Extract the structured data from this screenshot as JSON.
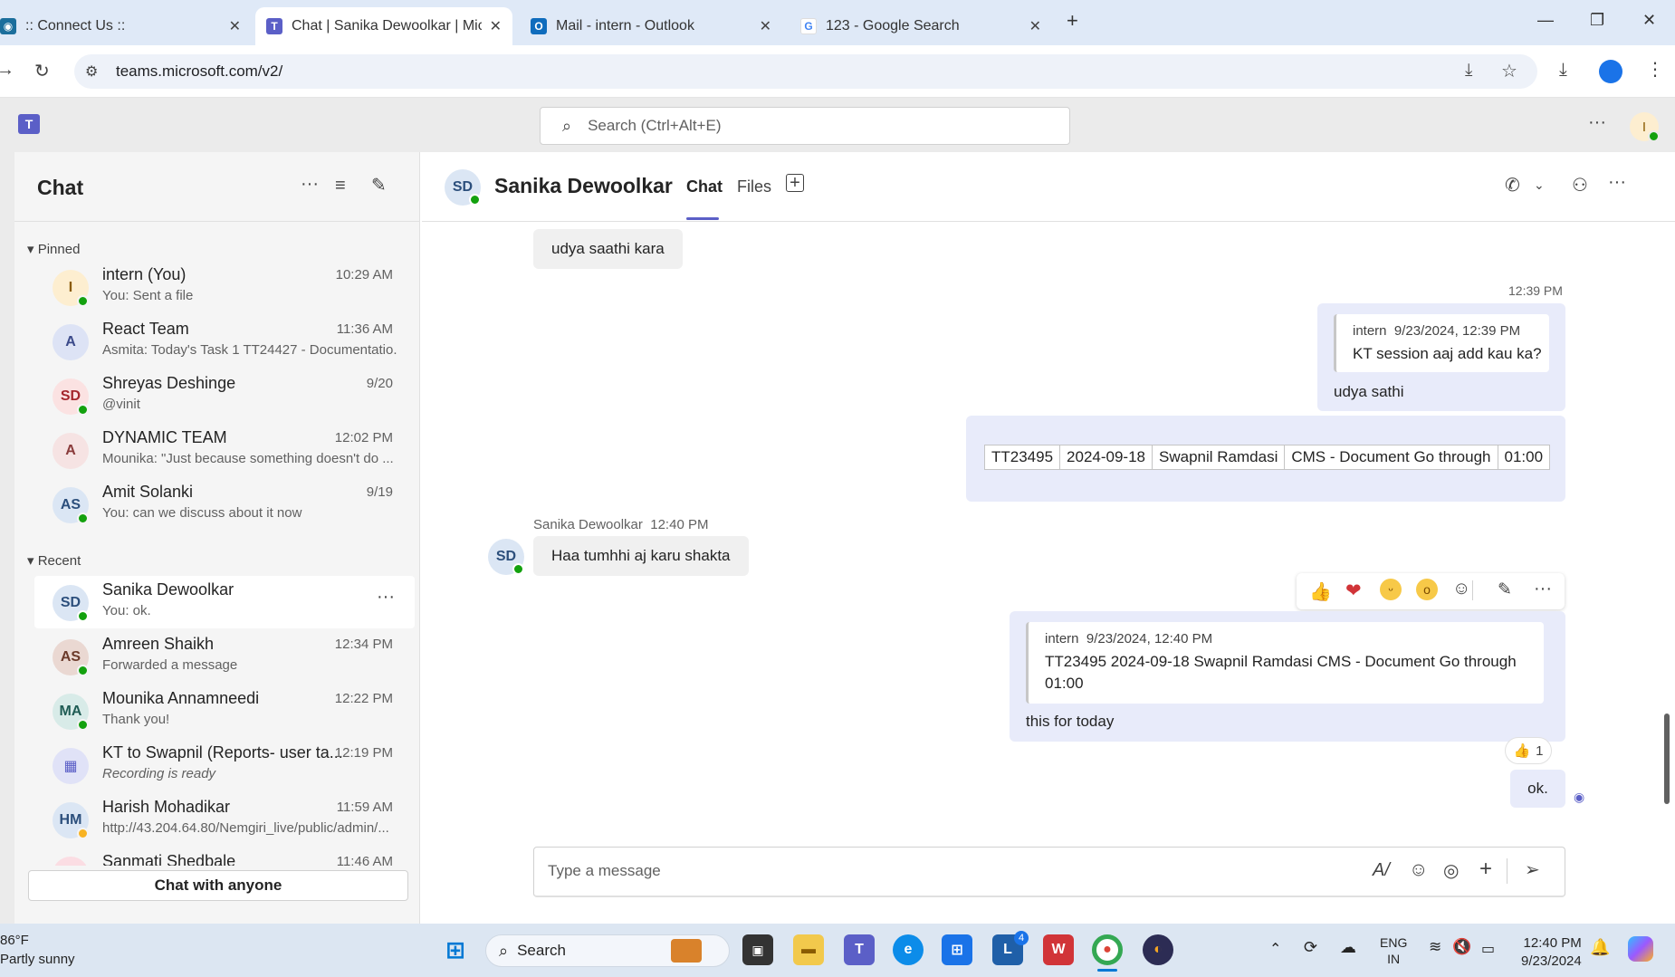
{
  "browser": {
    "tabs": [
      {
        "label": ":: Connect Us ::"
      },
      {
        "label": "Chat | Sanika Dewoolkar | Micro"
      },
      {
        "label": "Mail - intern - Outlook"
      },
      {
        "label": "123 - Google Search"
      }
    ],
    "url": "teams.microsoft.com/v2/"
  },
  "teams": {
    "search_placeholder": "Search (Ctrl+Alt+E)",
    "user_initial": "I"
  },
  "sidebar": {
    "title": "Chat",
    "pinned_label": "Pinned",
    "recent_label": "Recent",
    "chat_with_anyone": "Chat with anyone",
    "pinned": [
      {
        "initials": "I",
        "name": "intern (You)",
        "preview": "You: Sent a file",
        "time": "10:29 AM"
      },
      {
        "initials": "A",
        "name": "React Team",
        "preview": "Asmita: Today's Task 1 TT24427 - Documentatio...",
        "time": "11:36 AM"
      },
      {
        "initials": "SD",
        "name": "Shreyas Deshinge",
        "preview": "@vinit",
        "time": "9/20"
      },
      {
        "initials": "A",
        "name": "DYNAMIC TEAM",
        "preview": "Mounika: \"Just because something doesn't do ...",
        "time": "12:02 PM"
      },
      {
        "initials": "AS",
        "name": "Amit Solanki",
        "preview": "You: can we discuss about it now",
        "time": "9/19"
      }
    ],
    "recent": [
      {
        "initials": "SD",
        "name": "Sanika Dewoolkar",
        "preview": "You: ok.",
        "time": ""
      },
      {
        "initials": "AS",
        "name": "Amreen Shaikh",
        "preview": "Forwarded a message",
        "time": "12:34 PM"
      },
      {
        "initials": "MA",
        "name": "Mounika Annamneedi",
        "preview": "Thank you!",
        "time": "12:22 PM"
      },
      {
        "initials": "",
        "name": "KT to Swapnil (Reports- user ta...",
        "preview": "Recording is ready",
        "time": "12:19 PM"
      },
      {
        "initials": "HM",
        "name": "Harish Mohadikar",
        "preview": "http://43.204.64.80/Nemgiri_live/public/admin/...",
        "time": "11:59 AM"
      },
      {
        "initials": "",
        "name": "Sanmati Shedbale",
        "preview": "",
        "time": "11:46 AM"
      }
    ]
  },
  "chat": {
    "contact_initials": "SD",
    "contact_name": "Sanika Dewoolkar",
    "tab_chat": "Chat",
    "tab_files": "Files",
    "messages": {
      "m1_text": "udya saathi kara",
      "m2_time": "12:39 PM",
      "m2_quote_author": "intern",
      "m2_quote_time": "9/23/2024, 12:39 PM",
      "m2_quote_text": "KT session aaj add kau ka?",
      "m2_text": "udya sathi",
      "m3_table": [
        "TT23495",
        "2024-09-18",
        "Swapnil Ramdasi",
        "CMS - Document Go through",
        "01:00"
      ],
      "m4_author": "Sanika Dewoolkar",
      "m4_time": "12:40 PM",
      "m4_text": "Haa tumhhi aj karu shakta",
      "m5_quote_author": "intern",
      "m5_quote_time": "9/23/2024, 12:40 PM",
      "m5_quote_line1": "TT23495 2024-09-18 Swapnil Ramdasi CMS - Document Go through",
      "m5_quote_line2": "01:00",
      "m5_text": "this for today",
      "m5_reaction_count": "1",
      "m6_text": "ok."
    },
    "composer_placeholder": "Type a message"
  },
  "taskbar": {
    "weather_temp": "86°F",
    "weather_desc": "Partly sunny",
    "search_label": "Search",
    "lang_line1": "ENG",
    "lang_line2": "IN",
    "clock_time": "12:40 PM",
    "clock_date": "9/23/2024",
    "badge_count": "4"
  },
  "colors": {
    "accent": "#5b5fc7",
    "presence_green": "#13a10e",
    "presence_away": "#f8b323"
  }
}
